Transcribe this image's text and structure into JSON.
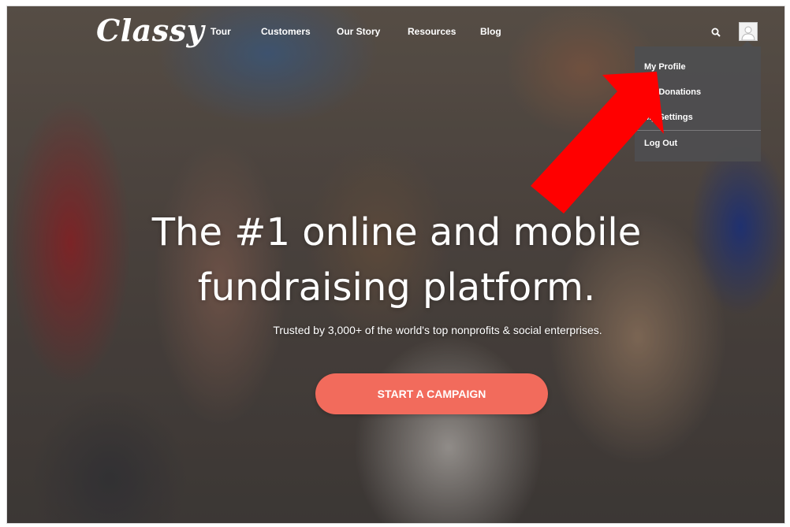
{
  "header": {
    "logo_text": "Classy",
    "nav_items": [
      "Tour",
      "Customers",
      "Our Story",
      "Resources",
      "Blog"
    ],
    "search_icon": "search-icon",
    "user_icon": "user-avatar-icon"
  },
  "user_menu": {
    "items": [
      "My Profile",
      "My Donations",
      "My Settings"
    ],
    "logout": "Log Out"
  },
  "annotation": {
    "color": "#ff0000",
    "shape": "arrow"
  },
  "hero": {
    "headline_line1": "The #1 online and mobile",
    "headline_line2": "fundraising platform.",
    "subheadline": "Trusted by 3,000+ of the world's top nonprofits & social enterprises.",
    "cta_label": "START A CAMPAIGN",
    "cta_color": "#f26b5c"
  }
}
